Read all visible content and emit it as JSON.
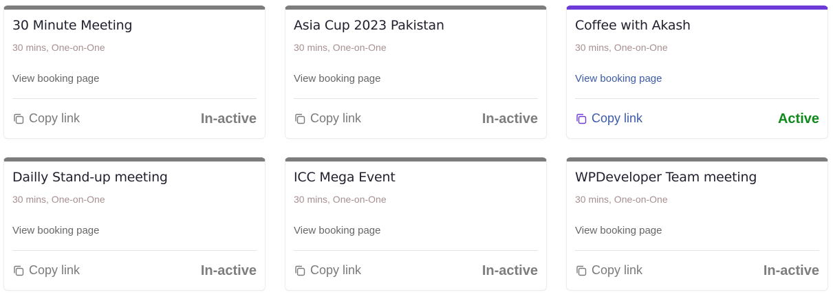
{
  "colors": {
    "inactive_bar": "#7d7d7d",
    "active_bar": "#6c3ad6",
    "active_status": "#0e8a1a",
    "link_blue": "#3d5aa8"
  },
  "cards": [
    {
      "title": "30 Minute Meeting",
      "meta": "30 mins, One-on-One",
      "view_label": "View booking page",
      "copy_label": "Copy link",
      "copy_icon": "copy-icon",
      "status": "In-active"
    },
    {
      "title": "Asia Cup 2023 Pakistan",
      "meta": "30 mins, One-on-One",
      "view_label": "View booking page",
      "copy_label": "Copy link",
      "copy_icon": "copy-icon",
      "status": "In-active"
    },
    {
      "title": "Coffee with Akash",
      "meta": "30 mins, One-on-One",
      "view_label": "View booking page",
      "copy_label": "Copy link",
      "copy_icon": "copy-icon",
      "status": "Active"
    },
    {
      "title": "Dailly Stand-up meeting",
      "meta": "30 mins, One-on-One",
      "view_label": "View booking page",
      "copy_label": "Copy link",
      "copy_icon": "copy-icon",
      "status": "In-active"
    },
    {
      "title": "ICC Mega Event",
      "meta": "30 mins, One-on-One",
      "view_label": "View booking page",
      "copy_label": "Copy link",
      "copy_icon": "copy-icon",
      "status": "In-active"
    },
    {
      "title": "WPDeveloper Team meeting",
      "meta": "30 mins, One-on-One",
      "view_label": "View booking page",
      "copy_label": "Copy link",
      "copy_icon": "copy-icon",
      "status": "In-active"
    }
  ]
}
